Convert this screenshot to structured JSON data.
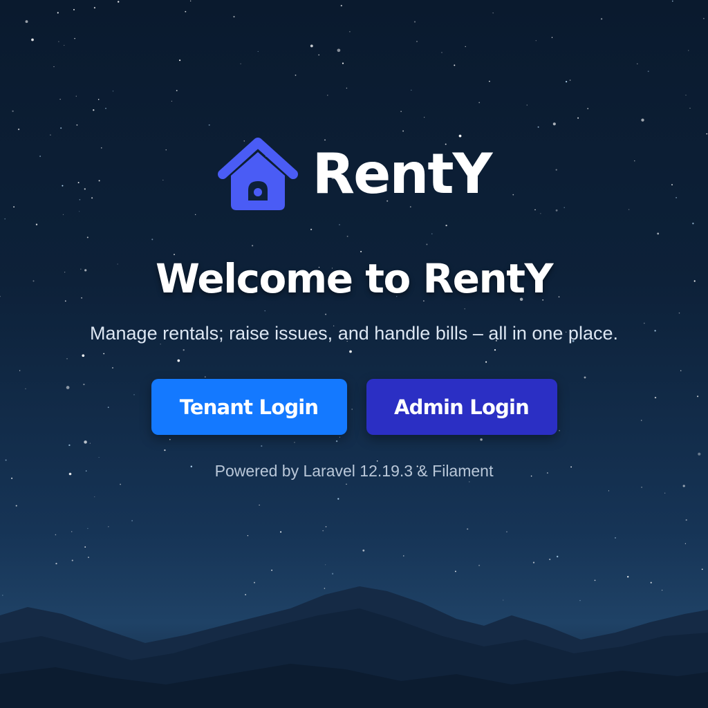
{
  "brand": {
    "name": "RentY",
    "icon": "house-icon",
    "icon_color": "#4a5cf5"
  },
  "hero": {
    "headline": "Welcome to RentY",
    "subtitle": "Manage rentals; raise issues, and handle bills – all in one place."
  },
  "actions": {
    "tenant_login_label": "Tenant Login",
    "tenant_login_color": "#1479ff",
    "admin_login_label": "Admin Login",
    "admin_login_color": "#2b2fc4"
  },
  "footer": {
    "text": "Powered by Laravel 12.19.3 & Filament"
  },
  "theme": {
    "background": "night-sky-with-stars",
    "mountains": "mountain-silhouette"
  }
}
